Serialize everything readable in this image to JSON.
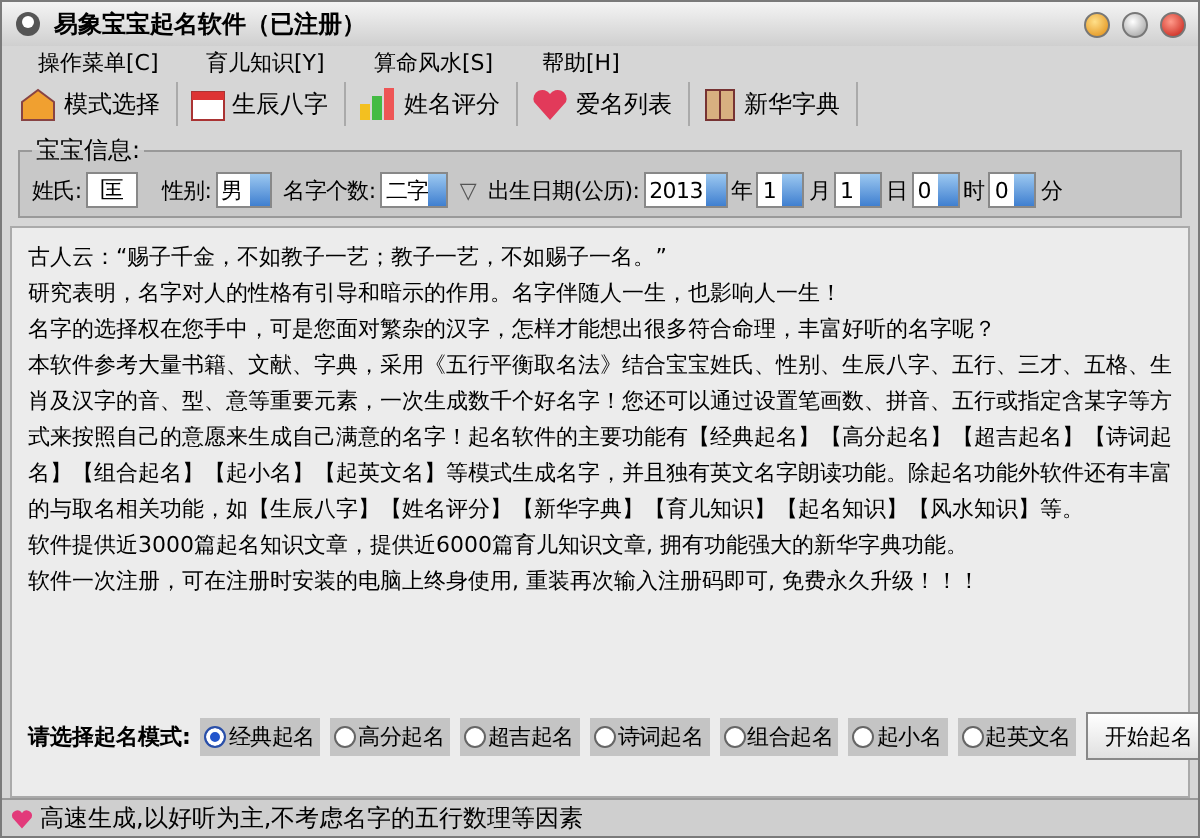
{
  "window": {
    "title": "易象宝宝起名软件（已注册）"
  },
  "menu": [
    {
      "label": "操作菜单[C]"
    },
    {
      "label": "育儿知识[Y]"
    },
    {
      "label": "算命风水[S]"
    },
    {
      "label": "帮助[H]"
    }
  ],
  "toolbar": [
    {
      "label": "模式选择",
      "kind": "house"
    },
    {
      "label": "生辰八字",
      "kind": "calendar"
    },
    {
      "label": "姓名评分",
      "kind": "bars"
    },
    {
      "label": "爱名列表",
      "kind": "heart"
    },
    {
      "label": "新华字典",
      "kind": "book"
    }
  ],
  "baby_info": {
    "title": "宝宝信息:",
    "fields": [
      {
        "kind": "text",
        "label": "姓氏:",
        "value": "匡"
      },
      {
        "kind": "select",
        "label": "性别:",
        "value": "男"
      },
      {
        "kind": "select",
        "label": "名字个数:",
        "value": "二字"
      },
      {
        "kind": "mark",
        "label": "▽"
      },
      {
        "kind": "label",
        "label": "出生日期(公历):"
      },
      {
        "kind": "select",
        "value": "2013",
        "unit": "年"
      },
      {
        "kind": "select",
        "value": "1",
        "unit": "月"
      },
      {
        "kind": "select",
        "value": "1",
        "unit": "日"
      },
      {
        "kind": "select",
        "value": "0",
        "unit": "时"
      },
      {
        "kind": "select",
        "value": "0",
        "unit": "分"
      }
    ]
  },
  "paragraphs": [
    "古人云：“赐子千金，不如教子一艺；教子一艺，不如赐子一名。”",
    "研究表明，名字对人的性格有引导和暗示的作用。名字伴随人一生，也影响人一生！",
    "名字的选择权在您手中，可是您面对繁杂的汉字，怎样才能想出很多符合命理，丰富好听的名字呢？",
    "本软件参考大量书籍、文献、字典，采用《五行平衡取名法》结合宝宝姓氏、性别、生辰八字、五行、三才、五格、生肖及汉字的音、型、意等重要元素，一次生成数千个好名字！您还可以通过设置笔画数、拼音、五行或指定含某字等方式来按照自己的意愿来生成自己满意的名字！起名软件的主要功能有【经典起名】【高分起名】【超吉起名】【诗词起名】【组合起名】【起小名】【起英文名】等模式生成名字，并且独有英文名字朗读功能。除起名功能外软件还有丰富的与取名相关功能，如【生辰八字】【姓名评分】【新华字典】【育儿知识】【起名知识】【风水知识】等。",
    "软件提供近3000篇起名知识文章，提供近6000篇育儿知识文章, 拥有功能强大的新华字典功能。",
    "软件一次注册，可在注册时安装的电脑上终身使用, 重装再次输入注册码即可, 免费永久升级！！！"
  ],
  "mode_prompt": "请选择起名模式:",
  "modes": [
    {
      "label": "经典起名",
      "selected": true
    },
    {
      "label": "高分起名",
      "selected": false
    },
    {
      "label": "超吉起名",
      "selected": false
    },
    {
      "label": "诗词起名",
      "selected": false
    },
    {
      "label": "组合起名",
      "selected": false
    },
    {
      "label": "起小名",
      "selected": false
    },
    {
      "label": "起英文名",
      "selected": false
    }
  ],
  "start_button": "开始起名",
  "status_bar": {
    "text": "高速生成,以好听为主,不考虑名字的五行数理等因素"
  }
}
